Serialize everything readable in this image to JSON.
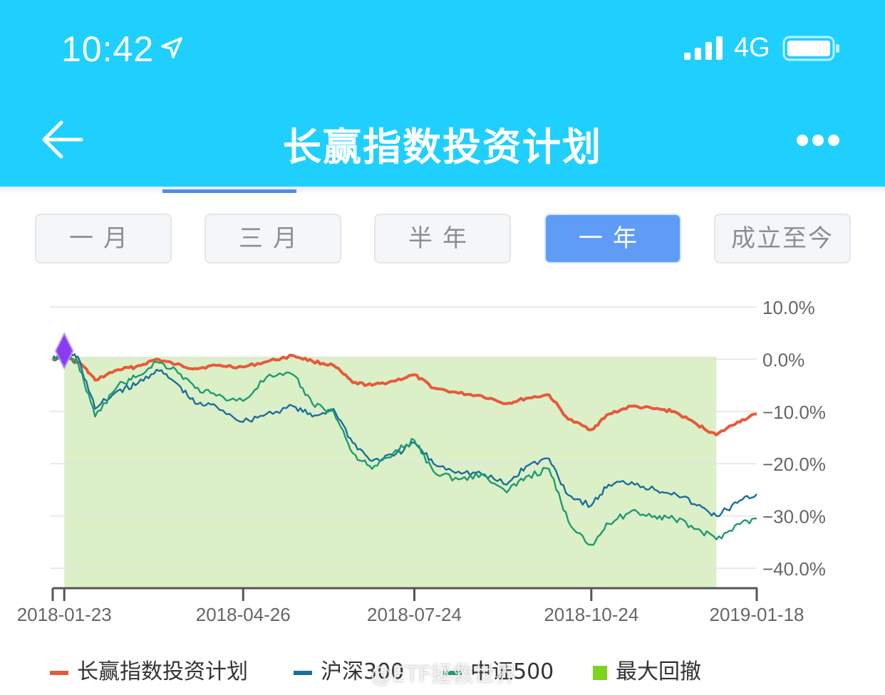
{
  "status_bar": {
    "time": "10:42",
    "network": "4G",
    "location_icon": "location-arrow-icon",
    "signal_icon": "signal-bars-icon",
    "battery_icon": "battery-icon"
  },
  "nav": {
    "title": "长赢指数投资计划",
    "back_icon": "back-arrow-icon",
    "more_icon": "more-dots-icon"
  },
  "range_tabs": [
    {
      "label": "一月",
      "active": false
    },
    {
      "label": "三月",
      "active": false
    },
    {
      "label": "半年",
      "active": false
    },
    {
      "label": "一年",
      "active": true
    },
    {
      "label": "成立至今",
      "active": false
    }
  ],
  "colors": {
    "header_bg": "#1fd0fe",
    "plan": "#e8593a",
    "hs300": "#1a6f9a",
    "zz500": "#1f9a70",
    "drawdown": "#dbf0c6",
    "drawdown_legend": "#7ed321",
    "marker": "#8a3df0",
    "active_tab": "#5e9cf6"
  },
  "chart_data": {
    "type": "line",
    "x_ticks": [
      "2018-01-23",
      "2018-04-26",
      "2018-07-24",
      "2018-10-24",
      "2019-01-18"
    ],
    "y_ticks": [
      "10.0%",
      "0.0%",
      "−10.0%",
      "−20.0%",
      "−30.0%",
      "−40.0%"
    ],
    "ylim": [
      -44,
      10
    ],
    "xlim": [
      "2018-01-17",
      "2019-01-18"
    ],
    "grid": true,
    "legend_position": "bottom",
    "series": [
      {
        "name": "长赢指数投资计划",
        "color": "#e8593a",
        "points": [
          [
            "2018-01-17",
            0.0
          ],
          [
            "2018-01-23",
            0.5
          ],
          [
            "2018-02-01",
            -1.0
          ],
          [
            "2018-02-08",
            -4.0
          ],
          [
            "2018-02-20",
            -2.0
          ],
          [
            "2018-03-01",
            -1.5
          ],
          [
            "2018-03-12",
            0.0
          ],
          [
            "2018-03-22",
            -1.0
          ],
          [
            "2018-04-01",
            -1.8
          ],
          [
            "2018-04-12",
            -1.2
          ],
          [
            "2018-04-26",
            -1.5
          ],
          [
            "2018-05-08",
            -0.5
          ],
          [
            "2018-05-22",
            0.7
          ],
          [
            "2018-06-01",
            -0.4
          ],
          [
            "2018-06-12",
            -1.2
          ],
          [
            "2018-06-22",
            -4.5
          ],
          [
            "2018-07-02",
            -5.0
          ],
          [
            "2018-07-13",
            -4.2
          ],
          [
            "2018-07-24",
            -3.0
          ],
          [
            "2018-08-03",
            -5.5
          ],
          [
            "2018-08-16",
            -6.5
          ],
          [
            "2018-08-28",
            -7.0
          ],
          [
            "2018-09-10",
            -8.5
          ],
          [
            "2018-09-20",
            -7.5
          ],
          [
            "2018-10-02",
            -6.8
          ],
          [
            "2018-10-12",
            -11.5
          ],
          [
            "2018-10-24",
            -13.5
          ],
          [
            "2018-11-02",
            -10.5
          ],
          [
            "2018-11-14",
            -9.0
          ],
          [
            "2018-11-26",
            -9.5
          ],
          [
            "2018-12-06",
            -10.0
          ],
          [
            "2018-12-18",
            -12.5
          ],
          [
            "2018-12-28",
            -14.5
          ],
          [
            "2019-01-08",
            -12.0
          ],
          [
            "2019-01-18",
            -10.5
          ]
        ]
      },
      {
        "name": "沪深300",
        "color": "#1a6f9a",
        "points": [
          [
            "2018-01-17",
            0.0
          ],
          [
            "2018-01-23",
            0.8
          ],
          [
            "2018-01-30",
            0.5
          ],
          [
            "2018-02-08",
            -9.5
          ],
          [
            "2018-02-20",
            -6.0
          ],
          [
            "2018-03-01",
            -5.0
          ],
          [
            "2018-03-12",
            -2.0
          ],
          [
            "2018-03-22",
            -4.5
          ],
          [
            "2018-04-01",
            -8.5
          ],
          [
            "2018-04-12",
            -9.0
          ],
          [
            "2018-04-26",
            -12.0
          ],
          [
            "2018-05-08",
            -10.5
          ],
          [
            "2018-05-22",
            -9.0
          ],
          [
            "2018-06-01",
            -11.0
          ],
          [
            "2018-06-12",
            -9.5
          ],
          [
            "2018-06-22",
            -16.0
          ],
          [
            "2018-07-02",
            -19.5
          ],
          [
            "2018-07-13",
            -18.5
          ],
          [
            "2018-07-24",
            -16.0
          ],
          [
            "2018-08-03",
            -20.0
          ],
          [
            "2018-08-16",
            -21.5
          ],
          [
            "2018-08-28",
            -22.0
          ],
          [
            "2018-09-10",
            -24.0
          ],
          [
            "2018-09-20",
            -20.5
          ],
          [
            "2018-10-02",
            -19.0
          ],
          [
            "2018-10-12",
            -26.0
          ],
          [
            "2018-10-24",
            -28.0
          ],
          [
            "2018-11-02",
            -24.0
          ],
          [
            "2018-11-14",
            -23.5
          ],
          [
            "2018-11-26",
            -25.0
          ],
          [
            "2018-12-06",
            -25.5
          ],
          [
            "2018-12-18",
            -28.0
          ],
          [
            "2018-12-28",
            -30.0
          ],
          [
            "2019-01-08",
            -27.5
          ],
          [
            "2019-01-18",
            -25.8
          ]
        ]
      },
      {
        "name": "中证500",
        "color": "#1f9a70",
        "points": [
          [
            "2018-01-17",
            0.0
          ],
          [
            "2018-01-23",
            0.8
          ],
          [
            "2018-01-30",
            -0.5
          ],
          [
            "2018-02-08",
            -11.0
          ],
          [
            "2018-02-20",
            -5.0
          ],
          [
            "2018-03-01",
            -3.5
          ],
          [
            "2018-03-12",
            -0.5
          ],
          [
            "2018-03-22",
            -2.0
          ],
          [
            "2018-04-01",
            -5.5
          ],
          [
            "2018-04-12",
            -7.0
          ],
          [
            "2018-04-26",
            -8.0
          ],
          [
            "2018-05-08",
            -3.5
          ],
          [
            "2018-05-22",
            -3.0
          ],
          [
            "2018-06-01",
            -8.5
          ],
          [
            "2018-06-12",
            -10.0
          ],
          [
            "2018-06-22",
            -18.0
          ],
          [
            "2018-07-02",
            -21.0
          ],
          [
            "2018-07-13",
            -18.0
          ],
          [
            "2018-07-24",
            -15.5
          ],
          [
            "2018-08-03",
            -21.5
          ],
          [
            "2018-08-16",
            -23.0
          ],
          [
            "2018-08-28",
            -22.0
          ],
          [
            "2018-09-10",
            -25.5
          ],
          [
            "2018-09-20",
            -22.5
          ],
          [
            "2018-10-02",
            -21.0
          ],
          [
            "2018-10-12",
            -31.0
          ],
          [
            "2018-10-24",
            -35.5
          ],
          [
            "2018-11-02",
            -31.5
          ],
          [
            "2018-11-14",
            -29.0
          ],
          [
            "2018-11-26",
            -30.0
          ],
          [
            "2018-12-06",
            -30.5
          ],
          [
            "2018-12-18",
            -32.5
          ],
          [
            "2018-12-28",
            -34.5
          ],
          [
            "2019-01-08",
            -31.5
          ],
          [
            "2019-01-18",
            -30.5
          ]
        ]
      }
    ],
    "drawdown": {
      "name": "最大回撤",
      "start": "2018-01-23",
      "end": "2018-12-28",
      "peak": 0.5,
      "trough": -14.5
    }
  },
  "legend": [
    {
      "label": "长赢指数投资计划",
      "color": "#e8593a"
    },
    {
      "label": "沪深300",
      "color": "#1a6f9a"
    },
    {
      "label": "中证500",
      "color": "#1f9a70"
    },
    {
      "label": "最大回撤",
      "color": "#7ed321"
    }
  ],
  "watermark": "@ETF拯救世界"
}
